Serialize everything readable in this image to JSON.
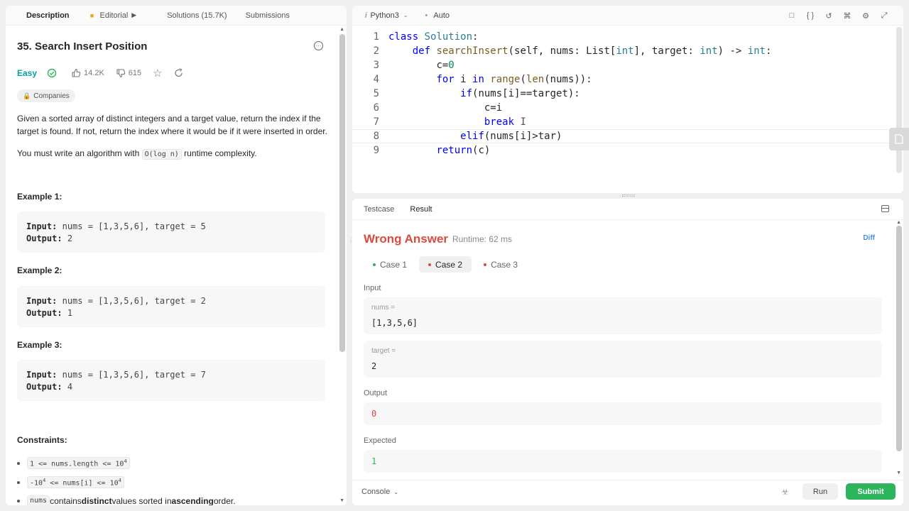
{
  "left_tabs": [
    {
      "label": "Description",
      "active": true
    },
    {
      "label": "Editorial"
    },
    {
      "label": "Solutions (15.7K)"
    },
    {
      "label": "Submissions"
    }
  ],
  "problem": {
    "title": "35. Search Insert Position",
    "difficulty": "Easy",
    "likes": "14.2K",
    "dislikes": "615",
    "companies_label": "Companies",
    "desc1": "Given a sorted array of distinct integers and a target value, return the index if the target is found. If not, return the index where it would be if it were inserted in order.",
    "desc2_prefix": "You must write an algorithm with ",
    "desc2_code": "O(log n)",
    "desc2_suffix": " runtime complexity.",
    "examples": [
      {
        "title": "Example 1:",
        "input_label": "Input:",
        "input": "nums = [1,3,5,6], target = 5",
        "output_label": "Output:",
        "output": "2"
      },
      {
        "title": "Example 2:",
        "input_label": "Input:",
        "input": "nums = [1,3,5,6], target = 2",
        "output_label": "Output:",
        "output": "1"
      },
      {
        "title": "Example 3:",
        "input_label": "Input:",
        "input": "nums = [1,3,5,6], target = 7",
        "output_label": "Output:",
        "output": "4"
      }
    ],
    "constraints_title": "Constraints:",
    "constraint1": "1 <= nums.length <= 10",
    "constraint1_sup": "4",
    "constraint2_a": "-10",
    "constraint2_sup1": "4",
    "constraint2_b": " <= nums[i] <= 10",
    "constraint2_sup2": "4",
    "constraint3_code": "nums",
    "constraint3_a": " contains ",
    "constraint3_b": "distinct",
    "constraint3_c": " values sorted in ",
    "constraint3_d": "ascending",
    "constraint3_e": " order."
  },
  "editor": {
    "language": "Python3",
    "mode": "Auto",
    "line_numbers": [
      "1",
      "2",
      "3",
      "4",
      "5",
      "6",
      "7",
      "8",
      "9"
    ]
  },
  "result": {
    "tabs": [
      "Testcase",
      "Result"
    ],
    "verdict": "Wrong Answer",
    "runtime": "Runtime: 62 ms",
    "diff_label": "Diff",
    "cases": [
      "Case 1",
      "Case 2",
      "Case 3"
    ],
    "input_label": "Input",
    "var1_name": "nums =",
    "var1_value": "[1,3,5,6]",
    "var2_name": "target =",
    "var2_value": "2",
    "output_label": "Output",
    "output_value": "0",
    "expected_label": "Expected",
    "expected_value": "1",
    "console_label": "Console",
    "run_label": "Run",
    "submit_label": "Submit"
  },
  "colors": {
    "wrong": "#d94b3f",
    "easy": "#00a3a0",
    "submit": "#2db55d",
    "pass": "#2db55d"
  }
}
